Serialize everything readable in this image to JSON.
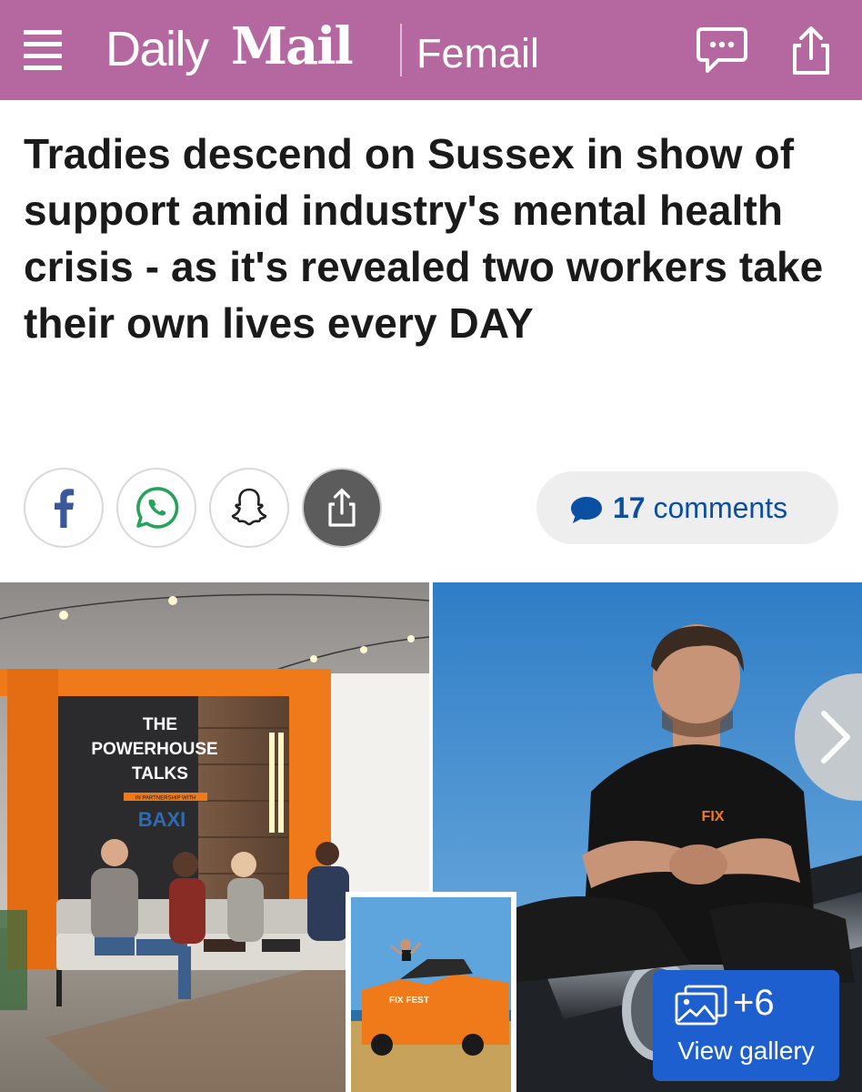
{
  "header": {
    "brand_daily": "Daily",
    "brand_mail": "Mail",
    "section": "Femail",
    "menu_icon": "hamburger-menu-icon",
    "comment_icon": "speech-bubble-icon",
    "share_icon": "share-icon",
    "background_color": "#b5679f"
  },
  "article": {
    "headline": "Tradies descend on Sussex in show of support amid industry's mental health crisis - as it's revealed two workers take their own lives every DAY"
  },
  "share_bar": {
    "buttons": [
      "facebook",
      "whatsapp",
      "snapchat",
      "share"
    ],
    "comment_count": "17",
    "comments_label": "comments",
    "accent_color": "#0b4fa3"
  },
  "image": {
    "sign_line1": "THE",
    "sign_line2": "POWERHOUSE",
    "sign_line3": "TALKS",
    "sign_partner": "IN PARTNERSHIP WITH",
    "sign_brand": "BAXI",
    "shirt_logo": "FIX",
    "van_logo": "FIX FEST",
    "gallery_count": "+6",
    "gallery_label": "View gallery",
    "gallery_color": "#1e5fd0"
  }
}
